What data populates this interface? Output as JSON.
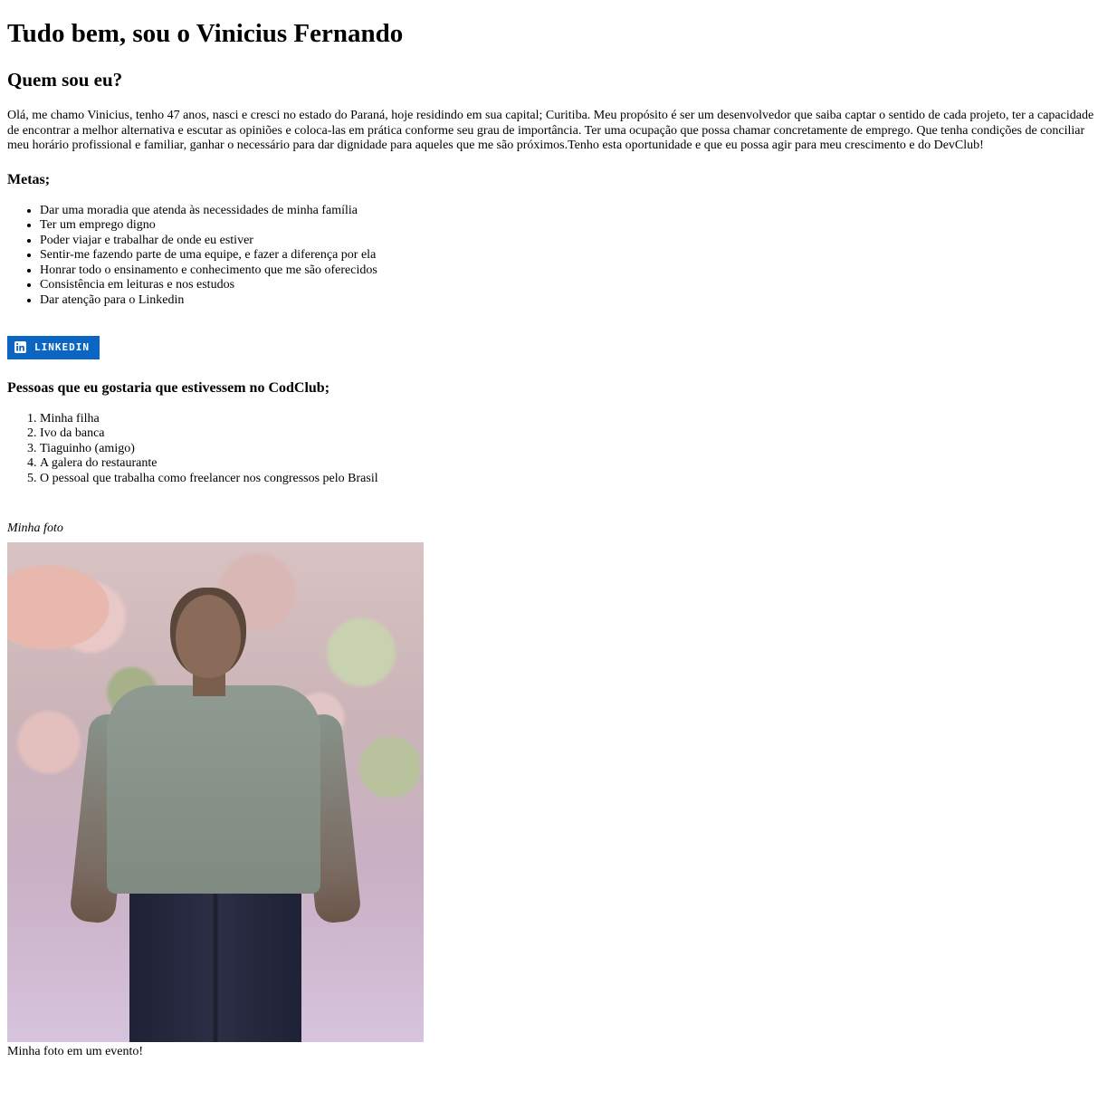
{
  "header": {
    "title": "Tudo bem, sou o Vinicius Fernando"
  },
  "about": {
    "heading": "Quem sou eu?",
    "text": "Olá, me chamo Vinicius, tenho 47 anos, nasci e cresci no estado do Paraná, hoje residindo em sua capital; Curitiba. Meu propósito é ser um desenvolvedor que saiba captar o sentido de cada projeto, ter a capacidade de encontrar a melhor alternativa e escutar as opiniões e coloca-las em prática conforme seu grau de importância. Ter uma ocupação que possa chamar concretamente de emprego. Que tenha condições de conciliar meu horário profissional e familiar, ganhar o necessário para dar dignidade para aqueles que me são próximos.Tenho esta oportunidade e que eu possa agir para meu crescimento e do DevClub!"
  },
  "goals": {
    "heading": "Metas;",
    "items": [
      "Dar uma moradia que atenda às necessidades de minha família",
      "Ter um emprego digno",
      "Poder viajar e trabalhar de onde eu estiver",
      "Sentir-me fazendo parte de uma equipe, e fazer a diferença por ela",
      "Honrar todo o ensinamento e conhecimento que me são oferecidos",
      "Consistência em leituras e nos estudos",
      "Dar atenção para o Linkedin"
    ]
  },
  "linkedin": {
    "label": "LINKEDIN",
    "icon": "linkedin-icon",
    "color": "#0a66c2"
  },
  "people": {
    "heading": "Pessoas que eu gostaria que estivessem no CodClub;",
    "items": [
      "Minha filha",
      "Ivo da banca",
      "Tiaguinho (amigo)",
      "A galera do restaurante",
      "O pessoal que trabalha como freelancer nos congressos pelo Brasil"
    ]
  },
  "photo": {
    "label": "Minha foto",
    "caption": "Minha foto em um evento!"
  }
}
